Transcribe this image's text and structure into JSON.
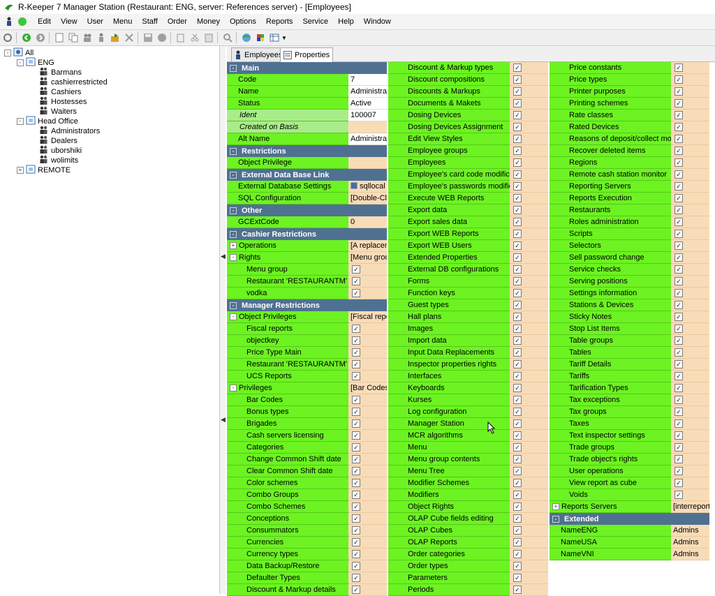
{
  "window": {
    "title": "R-Keeper 7 Manager Station (Restaurant: ENG, server: References server) - [Employees]"
  },
  "menu": [
    "Edit",
    "View",
    "User",
    "Menu",
    "Staff",
    "Order",
    "Money",
    "Options",
    "Reports",
    "Service",
    "Help",
    "Window"
  ],
  "tree": {
    "root": "All",
    "groups": [
      {
        "label": "ENG",
        "children": [
          "Barmans",
          "cashierrestricted",
          "Cashiers",
          "Hostesses",
          "Waiters"
        ]
      },
      {
        "label": "Head Office",
        "children": [
          "Administrators",
          "Dealers",
          "uborshiki",
          "wolimits"
        ]
      },
      {
        "label": "REMOTE",
        "children": []
      }
    ]
  },
  "tabs": [
    "Employees",
    "Properties"
  ],
  "col1": [
    {
      "t": "sec",
      "label": "Main",
      "pm": "-"
    },
    {
      "t": "p",
      "name": "Code",
      "value": "7",
      "edit": true
    },
    {
      "t": "p",
      "name": "Name",
      "value": "Administrato",
      "edit": true
    },
    {
      "t": "p",
      "name": "Status",
      "value": "Active",
      "edit": true
    },
    {
      "t": "p",
      "name": "Ident",
      "value": "100007",
      "edit": true,
      "italic": true
    },
    {
      "t": "p",
      "name": "Created on Basis",
      "value": "",
      "edit": false,
      "italic": true
    },
    {
      "t": "p",
      "name": "Alt Name",
      "value": "Administrato",
      "edit": true
    },
    {
      "t": "sec",
      "label": "Restrictions",
      "pm": "-"
    },
    {
      "t": "p",
      "name": "Object Privilege",
      "value": ""
    },
    {
      "t": "sec",
      "label": "External Data Base Link",
      "pm": "-"
    },
    {
      "t": "p",
      "name": "External Database Settings",
      "value": "sqllocal",
      "icon": true
    },
    {
      "t": "p",
      "name": "SQL Configuration",
      "value": "[Double-Clic"
    },
    {
      "t": "sec",
      "label": "Other",
      "pm": "-"
    },
    {
      "t": "p",
      "name": "GCExtCode",
      "value": "0"
    },
    {
      "t": "sec",
      "label": "Cashier Restrictions",
      "pm": "-"
    },
    {
      "t": "p",
      "name": "Operations",
      "value": "[A replacem",
      "pm": "+"
    },
    {
      "t": "p",
      "name": "Rights",
      "value": "[Menu grou",
      "pm": "-"
    },
    {
      "t": "c",
      "name": "Menu group"
    },
    {
      "t": "c",
      "name": "Restaurant 'RESTAURANTM'"
    },
    {
      "t": "c",
      "name": "vodka"
    },
    {
      "t": "sec",
      "label": "Manager Restrictions",
      "pm": "-"
    },
    {
      "t": "p",
      "name": "Object Privileges",
      "value": "[Fiscal repor",
      "pm": "-"
    },
    {
      "t": "c",
      "name": "Fiscal reports"
    },
    {
      "t": "c",
      "name": "objectkey"
    },
    {
      "t": "c",
      "name": "Price Type Main"
    },
    {
      "t": "c",
      "name": "Restaurant 'RESTAURANTM' obj"
    },
    {
      "t": "c",
      "name": "UCS Reports"
    },
    {
      "t": "p",
      "name": "Privileges",
      "value": "[Bar Codes,",
      "pm": "-"
    },
    {
      "t": "c",
      "name": "Bar Codes"
    },
    {
      "t": "c",
      "name": "Bonus types"
    },
    {
      "t": "c",
      "name": "Brigades"
    },
    {
      "t": "c",
      "name": "Cash servers licensing"
    },
    {
      "t": "c",
      "name": "Categories"
    },
    {
      "t": "c",
      "name": "Change Common Shift date"
    },
    {
      "t": "c",
      "name": "Clear Common Shift date"
    },
    {
      "t": "c",
      "name": "Color schemes"
    },
    {
      "t": "c",
      "name": "Combo Groups"
    },
    {
      "t": "c",
      "name": "Combo Schemes"
    },
    {
      "t": "c",
      "name": "Conceptions"
    },
    {
      "t": "c",
      "name": "Consummators"
    },
    {
      "t": "c",
      "name": "Currencies"
    },
    {
      "t": "c",
      "name": "Currency types"
    },
    {
      "t": "c",
      "name": "Data Backup/Restore"
    },
    {
      "t": "c",
      "name": "Defaulter Types"
    },
    {
      "t": "c",
      "name": "Discount & Markup details"
    }
  ],
  "col2": [
    "Discount & Markup types",
    "Discount compositions",
    "Discounts & Markups",
    "Documents & Makets",
    "Dosing Devices",
    "Dosing Devices Assignment",
    "Edit View Styles",
    "Employee groups",
    "Employees",
    "Employee's card code modification",
    "Employee's passwords modification",
    "Execute WEB Reports",
    "Export data",
    "Export sales data",
    "Export WEB Reports",
    "Export WEB Users",
    "Extended Properties",
    "External DB configurations",
    "Forms",
    "Function keys",
    "Guest types",
    "Hall plans",
    "Images",
    "Import data",
    "Input Data Replacements",
    "Inspector properties rights",
    "Interfaces",
    "Keyboards",
    "Kurses",
    "Log configuration",
    "Manager Station",
    "MCR algorithms",
    "Menu",
    "Menu group contents",
    "Menu Tree",
    "Modifier Schemes",
    "Modifiers",
    "Object Rights",
    "OLAP Cube fields editing",
    "OLAP Cubes",
    "OLAP Reports",
    "Order categories",
    "Order types",
    "Parameters",
    "Periods"
  ],
  "col3": [
    {
      "t": "c",
      "name": "Price constants"
    },
    {
      "t": "c",
      "name": "Price types"
    },
    {
      "t": "c",
      "name": "Printer purposes"
    },
    {
      "t": "c",
      "name": "Printing schemes"
    },
    {
      "t": "c",
      "name": "Rate classes"
    },
    {
      "t": "c",
      "name": "Rated Devices"
    },
    {
      "t": "c",
      "name": "Reasons of deposit/collect money"
    },
    {
      "t": "c",
      "name": "Recover deleted items"
    },
    {
      "t": "c",
      "name": "Regions"
    },
    {
      "t": "c",
      "name": "Remote cash station monitor"
    },
    {
      "t": "c",
      "name": "Reporting Servers"
    },
    {
      "t": "c",
      "name": "Reports Execution"
    },
    {
      "t": "c",
      "name": "Restaurants"
    },
    {
      "t": "c",
      "name": "Roles administration"
    },
    {
      "t": "c",
      "name": "Scripts"
    },
    {
      "t": "c",
      "name": "Selectors"
    },
    {
      "t": "c",
      "name": "Sell password change"
    },
    {
      "t": "c",
      "name": "Service checks"
    },
    {
      "t": "c",
      "name": "Serving positions"
    },
    {
      "t": "c",
      "name": "Settings information"
    },
    {
      "t": "c",
      "name": "Stations & Devices"
    },
    {
      "t": "c",
      "name": "Sticky Notes"
    },
    {
      "t": "c",
      "name": "Stop List Items"
    },
    {
      "t": "c",
      "name": "Table groups"
    },
    {
      "t": "c",
      "name": "Tables"
    },
    {
      "t": "c",
      "name": "Tariff Details"
    },
    {
      "t": "c",
      "name": "Tariffs"
    },
    {
      "t": "c",
      "name": "Tarification Types"
    },
    {
      "t": "c",
      "name": "Tax exceptions"
    },
    {
      "t": "c",
      "name": "Tax groups"
    },
    {
      "t": "c",
      "name": "Taxes"
    },
    {
      "t": "c",
      "name": "Text inspector settings"
    },
    {
      "t": "c",
      "name": "Trade groups"
    },
    {
      "t": "c",
      "name": "Trade object's rights"
    },
    {
      "t": "c",
      "name": "User operations"
    },
    {
      "t": "c",
      "name": "View report as cube"
    },
    {
      "t": "c",
      "name": "Voids"
    },
    {
      "t": "p",
      "name": "Reports Servers",
      "value": "[interreportn",
      "pm": "+"
    },
    {
      "t": "sec",
      "label": "Extended",
      "pm": "-"
    },
    {
      "t": "p",
      "name": "NameENG",
      "value": "Admins"
    },
    {
      "t": "p",
      "name": "NameUSA",
      "value": "Admins"
    },
    {
      "t": "p",
      "name": "NameVNI",
      "value": "Admins"
    }
  ],
  "check_mark": "✓",
  "colors": {
    "name_cell": "#6cf321",
    "value_cell": "#f8dcb8",
    "section": "#4f7191"
  }
}
